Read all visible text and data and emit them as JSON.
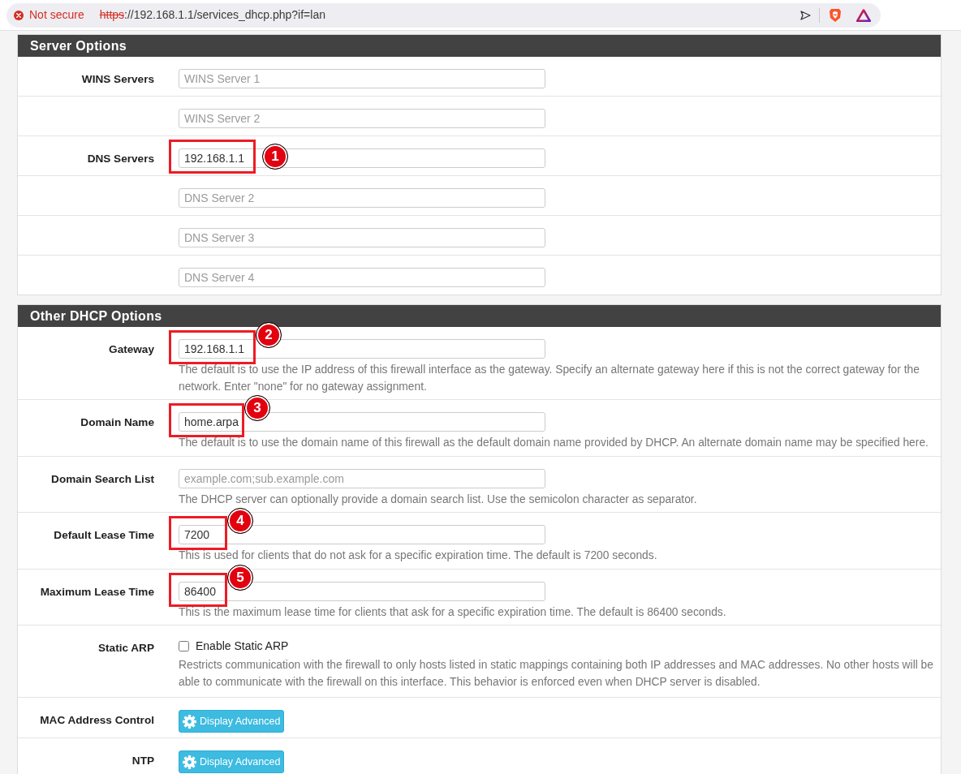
{
  "browser": {
    "security_label": "Not secure",
    "url_scheme": "https",
    "url_rest": "://192.168.1.1/services_dhcp.php?if=lan"
  },
  "panels": [
    {
      "title": "Server Options",
      "rows": [
        {
          "kind": "input",
          "label": "WINS Servers",
          "placeholder": "WINS Server 1"
        },
        {
          "kind": "input",
          "placeholder": "WINS Server 2"
        },
        {
          "kind": "input",
          "label": "DNS Servers",
          "value": "192.168.1.1",
          "callout": "1"
        },
        {
          "kind": "input",
          "placeholder": "DNS Server 2"
        },
        {
          "kind": "input",
          "placeholder": "DNS Server 3"
        },
        {
          "kind": "input",
          "placeholder": "DNS Server 4"
        }
      ]
    },
    {
      "title": "Other DHCP Options",
      "rows": [
        {
          "kind": "input",
          "label": "Gateway",
          "value": "192.168.1.1",
          "help": "The default is to use the IP address of this firewall interface as the gateway. Specify an alternate gateway here if this is not the correct gateway for the network. Enter \"none\" for no gateway assignment.",
          "callout": "2"
        },
        {
          "kind": "input",
          "label": "Domain Name",
          "value": "home.arpa",
          "help": "The default is to use the domain name of this firewall as the default domain name provided by DHCP. An alternate domain name may be specified here.",
          "callout": "3"
        },
        {
          "kind": "input",
          "label": "Domain Search List",
          "placeholder": "example.com;sub.example.com",
          "help": "The DHCP server can optionally provide a domain search list. Use the semicolon character as separator."
        },
        {
          "kind": "input",
          "label": "Default Lease Time",
          "value": "7200",
          "help": "This is used for clients that do not ask for a specific expiration time. The default is 7200 seconds.",
          "callout": "4"
        },
        {
          "kind": "input",
          "label": "Maximum Lease Time",
          "value": "86400",
          "help": "This is the maximum lease time for clients that ask for a specific expiration time. The default is 86400 seconds.",
          "callout": "5"
        },
        {
          "kind": "checkbox",
          "label": "Static ARP",
          "checkbox_label": "Enable Static ARP",
          "checked": false,
          "help": "Restricts communication with the firewall to only hosts listed in static mappings containing both IP addresses and MAC addresses. No other hosts will be able to communicate with the firewall on this interface. This behavior is enforced even when DHCP server is disabled."
        },
        {
          "kind": "button",
          "label": "MAC Address Control",
          "button": "Display Advanced"
        },
        {
          "kind": "button",
          "label": "NTP",
          "button": "Display Advanced"
        }
      ]
    }
  ]
}
